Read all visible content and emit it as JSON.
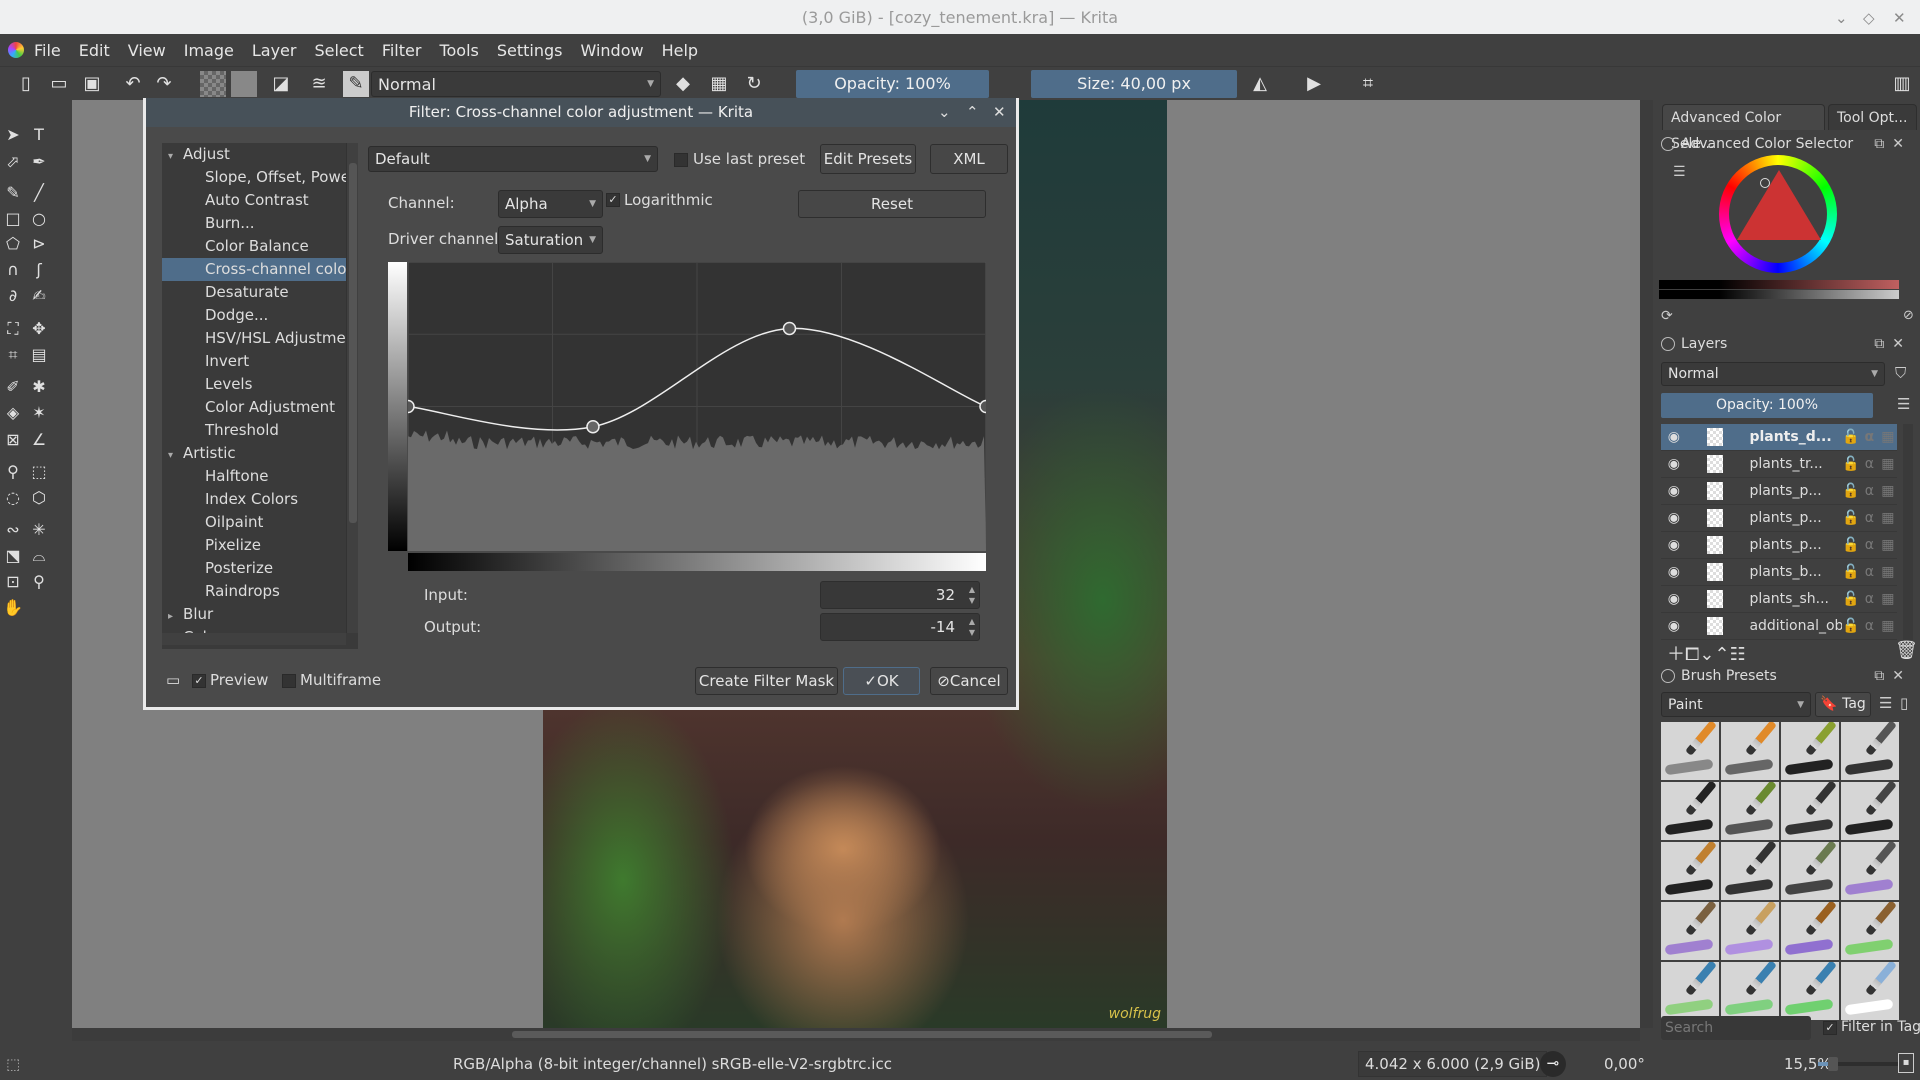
{
  "window": {
    "title": "(3,0 GiB) - [cozy_tenement.kra] — Krita"
  },
  "menu": [
    "File",
    "Edit",
    "View",
    "Image",
    "Layer",
    "Select",
    "Filter",
    "Tools",
    "Settings",
    "Window",
    "Help"
  ],
  "toolbar": {
    "blend_mode": "Normal",
    "opacity": "Opacity: 100%",
    "size": "Size: 40,00 px"
  },
  "toolbox_icons": [
    "select-shapes",
    "text",
    "edit-shapes",
    "calligraphy",
    "freehand-brush",
    "line",
    "rectangle",
    "ellipse",
    "polygon",
    "polyline",
    "bezier",
    "freehand-path",
    "dynamic-brush",
    "multibrush",
    "transform",
    "move",
    "crop",
    "gradient",
    "color-picker",
    "smart-patch",
    "fill",
    "colorize-mask",
    "assistant",
    "measure",
    "reference-image",
    "rect-select",
    "ellipse-select",
    "polygon-select",
    "freehand-select",
    "contiguous-select",
    "similar-select",
    "bezier-select",
    "magnetic-select",
    "zoom",
    "pan"
  ],
  "canvas": {
    "signature": "wolfrug"
  },
  "docker": {
    "tabs": [
      "Advanced Color Sele...",
      "Tool Opt..."
    ],
    "color_selector": {
      "title": "Advanced Color Selector",
      "current_color": "#c0392b"
    },
    "layers": {
      "title": "Layers",
      "blend_mode": "Normal",
      "opacity": "Opacity:  100%",
      "items": [
        {
          "name": "plants_d...",
          "selected": true
        },
        {
          "name": "plants_tr..."
        },
        {
          "name": "plants_p..."
        },
        {
          "name": "plants_p..."
        },
        {
          "name": "plants_p..."
        },
        {
          "name": "plants_b..."
        },
        {
          "name": "plants_sh..."
        },
        {
          "name": "additional_ob..."
        }
      ]
    },
    "brush_presets": {
      "title": "Brush Presets",
      "tag_filter": "Paint",
      "tag_label": "Tag",
      "search_placeholder": "Search",
      "filter_in_tag": "Filter in Tag",
      "count": 20
    }
  },
  "dialog": {
    "title": "Filter: Cross-channel color adjustment — Krita",
    "tree": [
      {
        "label": "Adjust",
        "group": true,
        "expanded": true
      },
      {
        "label": "Slope, Offset, Power"
      },
      {
        "label": "Auto Contrast"
      },
      {
        "label": "Burn..."
      },
      {
        "label": "Color Balance"
      },
      {
        "label": "Cross-channel color adjustment",
        "selected": true
      },
      {
        "label": "Desaturate"
      },
      {
        "label": "Dodge..."
      },
      {
        "label": "HSV/HSL Adjustment"
      },
      {
        "label": "Invert"
      },
      {
        "label": "Levels"
      },
      {
        "label": "Color Adjustment"
      },
      {
        "label": "Threshold"
      },
      {
        "label": "Artistic",
        "group": true,
        "expanded": true
      },
      {
        "label": "Halftone"
      },
      {
        "label": "Index Colors"
      },
      {
        "label": "Oilpaint"
      },
      {
        "label": "Pixelize"
      },
      {
        "label": "Posterize"
      },
      {
        "label": "Raindrops"
      },
      {
        "label": "Blur",
        "group": true,
        "expanded": false
      },
      {
        "label": "Colors",
        "group": true,
        "expanded": false
      }
    ],
    "preset": "Default",
    "use_last_preset": "Use last preset",
    "edit_presets": "Edit Presets",
    "xml": "XML",
    "channel_label": "Channel:",
    "channel": "Alpha",
    "logarithmic": "Logarithmic",
    "reset": "Reset",
    "driver_label": "Driver channel",
    "driver": "Saturation",
    "curve": {
      "points": [
        [
          0,
          0
        ],
        [
          32,
          -14
        ],
        [
          66,
          54
        ],
        [
          100,
          0
        ]
      ],
      "selected": 1,
      "xlim": [
        0,
        100
      ],
      "ylim": [
        -100,
        100
      ]
    },
    "input_label": "Input:",
    "input": "32",
    "output_label": "Output:",
    "output": "-14",
    "preview": "Preview",
    "multiframe": "Multiframe",
    "create_mask": "Create Filter Mask",
    "ok": "OK",
    "cancel": "Cancel"
  },
  "status": {
    "color_model": "RGB/Alpha (8-bit integer/channel)  sRGB-elle-V2-srgbtrc.icc",
    "dimensions": "4.042 x 6.000 (2,9 GiB)",
    "rotation": "0,00°",
    "zoom": "15,5%"
  }
}
